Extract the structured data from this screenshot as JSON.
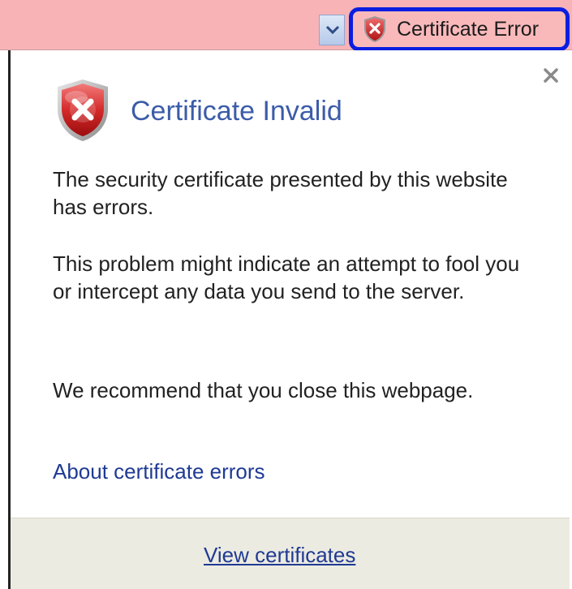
{
  "address_bar": {
    "dropdown_icon": "chevron-down-icon",
    "cert_error_button": {
      "label": "Certificate Error",
      "icon": "error-shield-icon"
    }
  },
  "popup": {
    "close_icon": "close-icon",
    "shield_icon": "error-shield-icon",
    "title": "Certificate Invalid",
    "paragraph_1": "The security certificate presented by this website has errors.",
    "paragraph_2": "This problem might indicate an attempt to fool you or intercept any data you send to the server.",
    "paragraph_3": "We recommend that you close this webpage.",
    "about_link": "About certificate errors",
    "view_certificates_link": "View certificates"
  },
  "colors": {
    "address_bar_bg": "#f8b3b6",
    "highlight_border": "#0a1de0",
    "title_color": "#3b5ca8",
    "link_color": "#1f3a93",
    "footer_bg": "#ecebe2"
  }
}
